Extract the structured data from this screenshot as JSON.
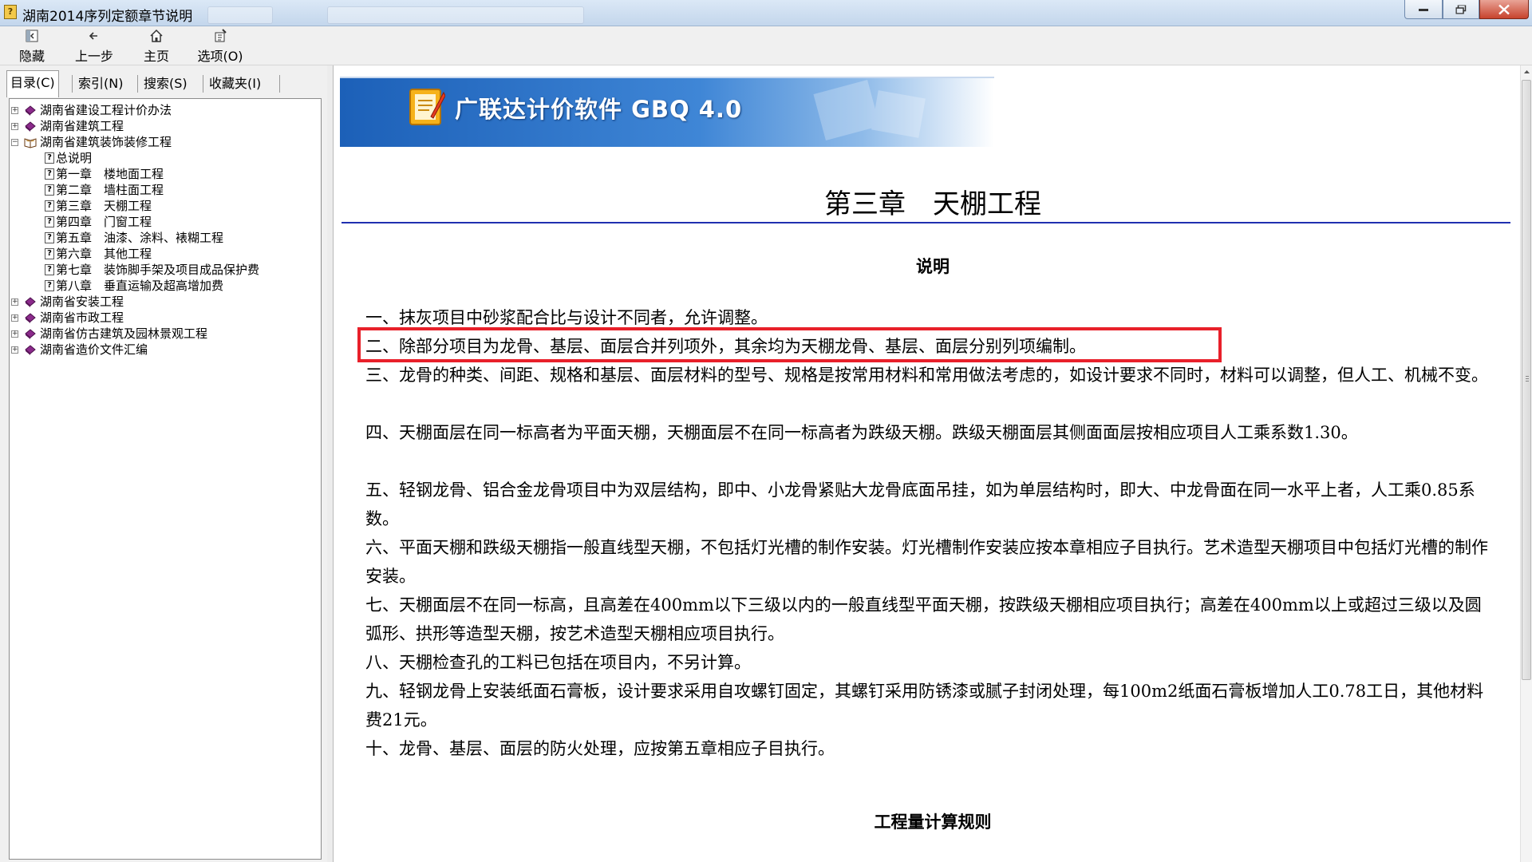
{
  "window": {
    "title": "湖南2014序列定额章节说明"
  },
  "toolbar": {
    "hide_label": "隐藏",
    "back_label": "上一步",
    "home_label": "主页",
    "options_label": "选项(O)"
  },
  "tabs": {
    "contents": "目录(C)",
    "index": "索引(N)",
    "search": "搜索(S)",
    "favorites": "收藏夹(I)"
  },
  "tree": {
    "items": [
      {
        "label": "湖南省建设工程计价办法",
        "state": "collapsed"
      },
      {
        "label": "湖南省建筑工程",
        "state": "collapsed"
      },
      {
        "label": "湖南省建筑装饰装修工程",
        "state": "expanded"
      },
      {
        "label": "总说明"
      },
      {
        "label": "第一章　楼地面工程"
      },
      {
        "label": "第二章　墙柱面工程"
      },
      {
        "label": "第三章　天棚工程"
      },
      {
        "label": "第四章　门窗工程"
      },
      {
        "label": "第五章　油漆、涂料、裱糊工程"
      },
      {
        "label": "第六章　其他工程"
      },
      {
        "label": "第七章　装饰脚手架及项目成品保护费"
      },
      {
        "label": "第八章　垂直运输及超高增加费"
      },
      {
        "label": "湖南省安装工程",
        "state": "collapsed"
      },
      {
        "label": "湖南省市政工程",
        "state": "collapsed"
      },
      {
        "label": "湖南省仿古建筑及园林景观工程",
        "state": "collapsed"
      },
      {
        "label": "湖南省造价文件汇编",
        "state": "collapsed"
      }
    ]
  },
  "content": {
    "banner_title": "广联达计价软件 GBQ 4.0",
    "chapter_title": "第三章　天棚工程",
    "section_heading": "说明",
    "paragraphs": [
      "一、抹灰项目中砂浆配合比与设计不同者，允许调整。",
      "二、除部分项目为龙骨、基层、面层合并列项外，其余均为天棚龙骨、基层、面层分别列项编制。",
      "三、龙骨的种类、间距、规格和基层、面层材料的型号、规格是按常用材料和常用做法考虑的，如设计要求不同时，材料可以调整，但人工、机械不变。",
      "四、天棚面层在同一标高者为平面天棚，天棚面层不在同一标高者为跌级天棚。跌级天棚面层其侧面面层按相应项目人工乘系数1.30。",
      "五、轻钢龙骨、铝合金龙骨项目中为双层结构，即中、小龙骨紧贴大龙骨底面吊挂，如为单层结构时，即大、中龙骨面在同一水平上者，人工乘0.85系数。",
      "六、平面天棚和跌级天棚指一般直线型天棚，不包括灯光槽的制作安装。灯光槽制作安装应按本章相应子目执行。艺术造型天棚项目中包括灯光槽的制作安装。",
      "七、天棚面层不在同一标高，且高差在400mm以下三级以内的一般直线型平面天棚，按跌级天棚相应项目执行；高差在400mm以上或超过三级以及圆弧形、拱形等造型天棚，按艺术造型天棚相应项目执行。",
      "八、天棚检查孔的工料已包括在项目内，不另计算。",
      "九、轻钢龙骨上安装纸面石膏板，设计要求采用自攻螺钉固定，其螺钉采用防锈漆或腻子封闭处理，每100m2纸面石膏板增加人工0.78工日，其他材料费21元。",
      "十、龙骨、基层、面层的防火处理，应按第五章相应子目执行。"
    ],
    "highlighted_paragraph_index": 1,
    "section_heading_2": "工程量计算规则"
  },
  "colors": {
    "highlight_border": "#e8202a",
    "title_rule": "#2030b0",
    "banner_blue": "#1c60b8"
  }
}
